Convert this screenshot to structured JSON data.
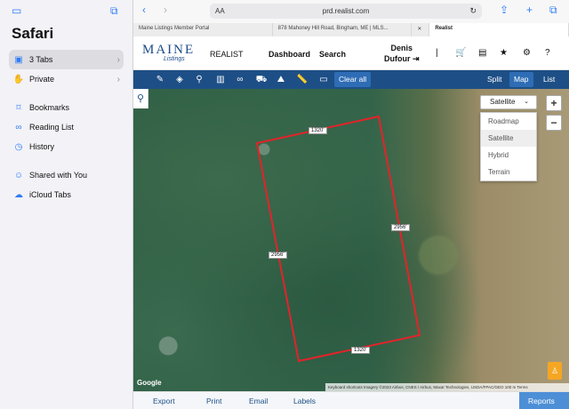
{
  "sidebar": {
    "title": "Safari",
    "items": [
      {
        "label": "3 Tabs",
        "icon": "tabs-icon"
      },
      {
        "label": "Private",
        "icon": "hand-icon"
      },
      {
        "label": "Bookmarks",
        "icon": "bookmark-icon"
      },
      {
        "label": "Reading List",
        "icon": "glasses-icon"
      },
      {
        "label": "History",
        "icon": "clock-icon"
      },
      {
        "label": "Shared with You",
        "icon": "people-icon"
      },
      {
        "label": "iCloud Tabs",
        "icon": "cloud-icon"
      }
    ]
  },
  "browser": {
    "aa_label": "AA",
    "url": "prd.realist.com",
    "tabs": [
      {
        "label": "Maine Listings Member Portal"
      },
      {
        "label": "878 Mahoney Hill Road, Bingham, ME | MLS..."
      },
      {
        "label": "Realist"
      }
    ]
  },
  "header": {
    "logo_text": "MAINE",
    "logo_sub": "Listings",
    "app_name": "REALIST",
    "nav": [
      "Dashboard",
      "Search"
    ],
    "user_first": "Denis",
    "user_last": "Dufour"
  },
  "toolbar": {
    "clear_all": "Clear all",
    "views": [
      "Split",
      "Map",
      "List"
    ],
    "active_view": "Map"
  },
  "map": {
    "maptype_selected": "Satellite",
    "maptype_options": [
      "Roadmap",
      "Satellite",
      "Hybrid",
      "Terrain"
    ],
    "parcel_labels": {
      "top": "1320'",
      "right": "2956'",
      "left": "2956'",
      "bottom": "1320'"
    },
    "google_label": "Google",
    "attribution": "Keyboard shortcuts   Imagery ©2023 Airbus, CNES / Airbus, Maxar Technologies, USDA/FPAC/GEO   100 m   Terms",
    "zoom_in": "+",
    "zoom_out": "−",
    "parcel_color": "#e3232a"
  },
  "bottom": {
    "items": [
      "Export",
      "Print",
      "Email",
      "Labels"
    ],
    "reports": "Reports"
  }
}
